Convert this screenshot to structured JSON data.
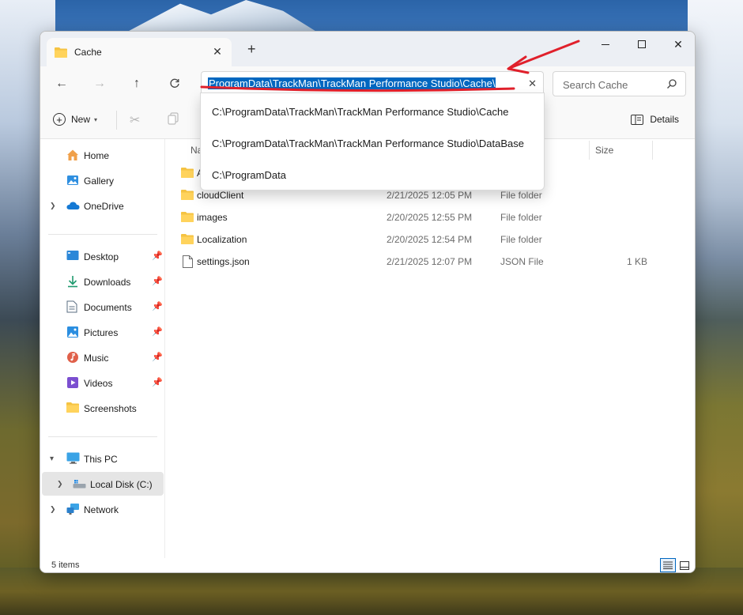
{
  "window": {
    "tab_title": "Cache",
    "new_tab": "+"
  },
  "nav": {
    "address_path": "C:\\ProgramData\\TrackMan\\TrackMan Performance Studio\\Cache",
    "address_visible": "\\ProgramData\\TrackMan\\TrackMan Performance Studio\\Cache",
    "search_placeholder": "Search Cache"
  },
  "toolbar": {
    "new_label": "New",
    "details_label": "Details"
  },
  "sidebar": {
    "items": [
      {
        "label": "Home",
        "icon": "home-icon"
      },
      {
        "label": "Gallery",
        "icon": "gallery-icon"
      },
      {
        "label": "OneDrive",
        "icon": "onedrive-icon"
      },
      {
        "label": "Desktop",
        "icon": "desktop-icon"
      },
      {
        "label": "Downloads",
        "icon": "downloads-icon"
      },
      {
        "label": "Documents",
        "icon": "documents-icon"
      },
      {
        "label": "Pictures",
        "icon": "pictures-icon"
      },
      {
        "label": "Music",
        "icon": "music-icon"
      },
      {
        "label": "Videos",
        "icon": "videos-icon"
      },
      {
        "label": "Screenshots",
        "icon": "folder-icon"
      },
      {
        "label": "This PC",
        "icon": "this-pc-icon"
      },
      {
        "label": "Local Disk (C:)",
        "icon": "drive-icon"
      },
      {
        "label": "Network",
        "icon": "network-icon"
      }
    ]
  },
  "columns": {
    "name": "Na",
    "size": "Size"
  },
  "files": [
    {
      "name": "A",
      "date": "",
      "type": "",
      "size": ""
    },
    {
      "name": "cloudClient",
      "date": "2/21/2025 12:05 PM",
      "type": "File folder",
      "size": ""
    },
    {
      "name": "images",
      "date": "2/20/2025 12:55 PM",
      "type": "File folder",
      "size": ""
    },
    {
      "name": "Localization",
      "date": "2/20/2025 12:54 PM",
      "type": "File folder",
      "size": ""
    },
    {
      "name": "settings.json",
      "date": "2/21/2025 12:07 PM",
      "type": "JSON File",
      "size": "1 KB"
    }
  ],
  "dropdown": {
    "items": [
      "C:\\ProgramData\\TrackMan\\TrackMan Performance Studio\\Cache",
      "C:\\ProgramData\\TrackMan\\TrackMan Performance Studio\\DataBase",
      "C:\\ProgramData"
    ]
  },
  "status": {
    "items_count": "5 items"
  },
  "colors": {
    "accent": "#0067c0",
    "annotation": "#e0202b",
    "folder": "#f5c342"
  }
}
